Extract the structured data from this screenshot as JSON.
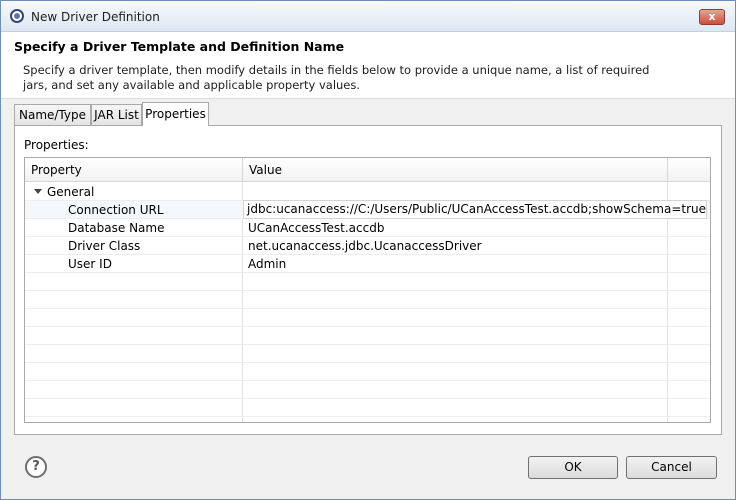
{
  "window": {
    "title": "New Driver Definition",
    "icon": "eclipse-icon",
    "close_label": "x"
  },
  "header": {
    "title": "Specify a Driver Template and Definition Name",
    "description": "Specify a driver template, then modify details in the fields below to provide a unique name, a list of required jars, and set any available and applicable property values."
  },
  "tabs": [
    {
      "label": "Name/Type",
      "active": false
    },
    {
      "label": "JAR List",
      "active": false
    },
    {
      "label": "Properties",
      "active": true
    }
  ],
  "properties_panel": {
    "label": "Properties:",
    "columns": [
      "Property",
      "Value"
    ],
    "group": "General",
    "rows": [
      {
        "property": "Connection URL",
        "value": "jdbc:ucanaccess://C:/Users/Public/UCanAccessTest.accdb;showSchema=true",
        "editing": true
      },
      {
        "property": "Database Name",
        "value": "UCanAccessTest.accdb"
      },
      {
        "property": "Driver Class",
        "value": "net.ucanaccess.jdbc.UcanaccessDriver"
      },
      {
        "property": "User ID",
        "value": "Admin"
      }
    ]
  },
  "footer": {
    "help_icon": "question-mark-icon",
    "ok_label": "OK",
    "cancel_label": "Cancel"
  }
}
